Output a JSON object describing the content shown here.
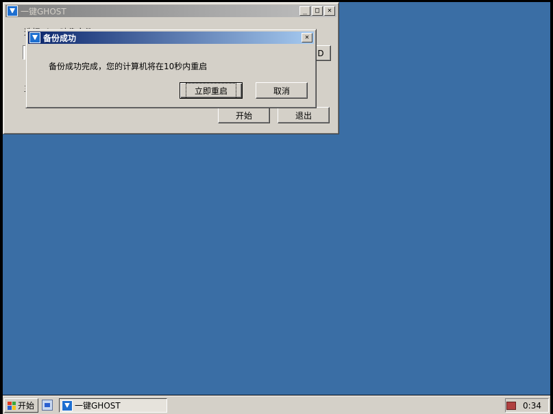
{
  "main_window": {
    "title": "一键GHOST",
    "label_select": "选择Gh...映像文件:",
    "label_partial": "主",
    "browse_button_partial": "D",
    "start_button": "开始",
    "exit_button": "退出",
    "controls": {
      "minimize": "_",
      "maximize": "□",
      "close": "✕"
    }
  },
  "dialog": {
    "title": "备份成功",
    "message": "备份成功完成，您的计算机将在10秒内重启",
    "restart_button": "立即重启",
    "cancel_button": "取消",
    "close": "✕"
  },
  "taskbar": {
    "start_label": "开始",
    "task_label": "一键GHOST",
    "clock": "0:34"
  },
  "colors": {
    "desktop": "#3a6ea5",
    "active_title_start": "#0a246a",
    "active_title_end": "#a6caf0",
    "window_face": "#d4d0c8"
  }
}
